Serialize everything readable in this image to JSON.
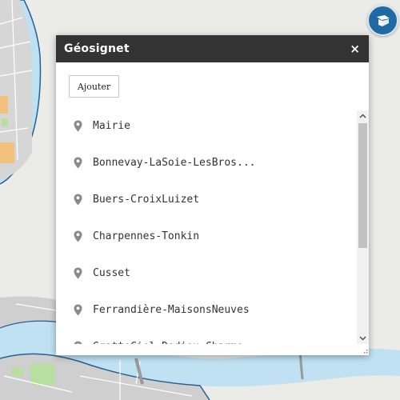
{
  "dialog": {
    "title": "Géosignet",
    "close_label": "×",
    "add_label": "Ajouter",
    "items": [
      {
        "label": "Mairie"
      },
      {
        "label": "Bonnevay-LaSoie-LesBros..."
      },
      {
        "label": "Buers-CroixLuizet"
      },
      {
        "label": "Charpennes-Tonkin"
      },
      {
        "label": "Cusset"
      },
      {
        "label": "Ferrandière-MaisonsNeuves"
      },
      {
        "label": "GratteCiel-Dedieu-Charme..."
      }
    ]
  },
  "icons": {
    "list_item": "map-pin-icon",
    "top_button": "bookmark-icon"
  },
  "colors": {
    "header_bg": "#333333",
    "top_button_bg": "#1f6aa5",
    "water": "#bfe1f1",
    "pin": "#8a8a8a"
  }
}
